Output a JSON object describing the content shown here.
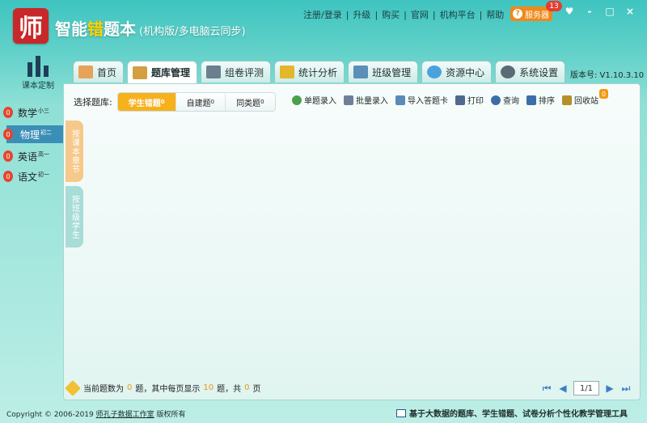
{
  "header": {
    "logo_glyph": "师",
    "title_pre": "智能",
    "title_accent": "错",
    "title_post": "题本",
    "title_sub": "(机构版/多电脑云同步)",
    "links": [
      "注册/登录",
      "升级",
      "购买",
      "官网",
      "机构平台",
      "帮助"
    ],
    "service_label": "服务器",
    "service_badge": "13",
    "window_controls": [
      "♥",
      "-",
      "□",
      "×"
    ]
  },
  "left": {
    "custom_course_label": "课本定制",
    "subjects": [
      {
        "name": "数学",
        "grade": "小三",
        "count": "0",
        "active": false
      },
      {
        "name": "物理",
        "grade": "初二",
        "count": "0",
        "active": true
      },
      {
        "name": "英语",
        "grade": "高一",
        "count": "0",
        "active": false
      },
      {
        "name": "语文",
        "grade": "初一",
        "count": "0",
        "active": false
      }
    ]
  },
  "tabs": [
    {
      "label": "首页",
      "icon": "home-icon",
      "color": "#e8a25a",
      "active": false
    },
    {
      "label": "题库管理",
      "icon": "clipboard-icon",
      "color": "#d2a042",
      "active": true
    },
    {
      "label": "组卷评测",
      "icon": "printer-icon",
      "color": "#6b7f8f",
      "active": false
    },
    {
      "label": "统计分析",
      "icon": "bar-chart-icon",
      "color": "#e3b62b",
      "active": false
    },
    {
      "label": "班级管理",
      "icon": "class-icon",
      "color": "#5a8fb8",
      "active": false
    },
    {
      "label": "资源中心",
      "icon": "cloud-icon",
      "color": "#4aa2dd",
      "active": false
    },
    {
      "label": "系统设置",
      "icon": "gear-icon",
      "color": "#5b6b76",
      "active": false
    }
  ],
  "version": "版本号: V1.10.3.10",
  "filter": {
    "label": "选择题库:",
    "options": [
      {
        "label": "学生错题",
        "count": "0",
        "active": true
      },
      {
        "label": "自建题",
        "count": "0",
        "active": false
      },
      {
        "label": "同类题",
        "count": "0",
        "active": false
      }
    ]
  },
  "toolbar": [
    {
      "label": "单题录入",
      "icon": "plus-circle-icon",
      "color": "#4aa14a"
    },
    {
      "label": "批量录入",
      "icon": "batch-doc-icon",
      "color": "#6f7f9a"
    },
    {
      "label": "导入答题卡",
      "icon": "import-card-icon",
      "color": "#5a8bb8"
    },
    {
      "label": "打印",
      "icon": "print-icon",
      "color": "#4f6a8c"
    },
    {
      "label": "查询",
      "icon": "search-icon",
      "color": "#3a6ea8"
    },
    {
      "label": "排序",
      "icon": "sort-icon",
      "color": "#3a6ea8"
    },
    {
      "label": "回收站",
      "icon": "recycle-bin-icon",
      "color": "#b5902a",
      "badge": "0"
    }
  ],
  "side_tabs": {
    "a": "按课本章节",
    "b": "按班级学生"
  },
  "status": {
    "prefix": "当前题数为",
    "total": "0",
    "mid": "题，其中每页显示",
    "per_page": "10",
    "mid2": "题，共",
    "pages": "0",
    "suffix": "页"
  },
  "pager": {
    "page": "1/1",
    "first": "⏮",
    "prev": "◀",
    "next": "▶",
    "last": "⏭"
  },
  "footer": {
    "copyright_pre": "Copyright © 2006-2019 ",
    "copyright_link": "师孔子数据工作室",
    "copyright_post": " 版权所有",
    "slogan": "基于大数据的题库、学生错题、试卷分析个性化教学管理工具"
  }
}
